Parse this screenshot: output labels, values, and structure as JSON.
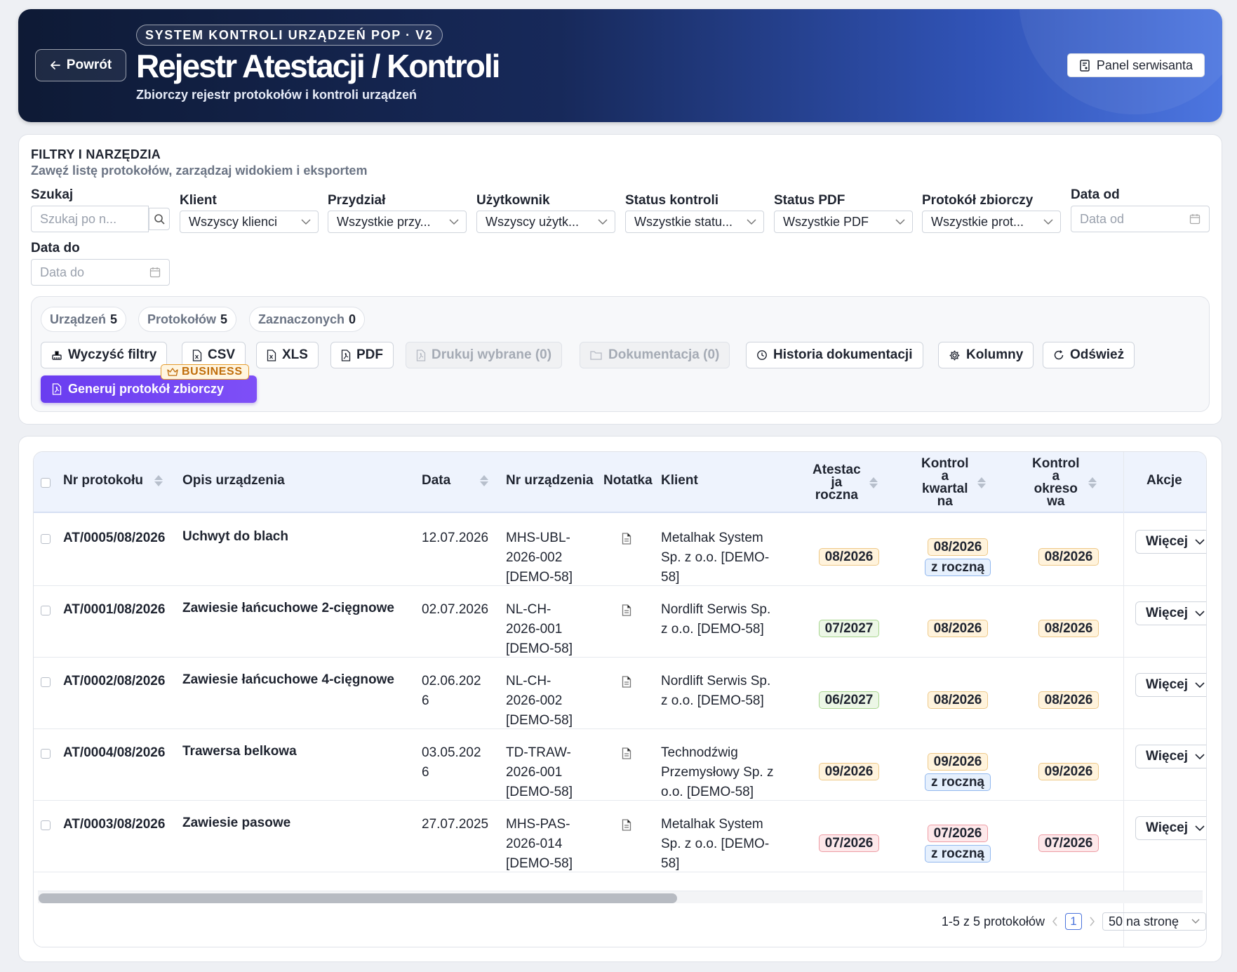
{
  "header": {
    "back_label": "Powrót",
    "badge": "SYSTEM KONTROLI URZĄDZEŃ POP · V2",
    "title": "Rejestr Atestacji / Kontroli",
    "subtitle": "Zbiorczy rejestr protokołów i kontroli urządzeń",
    "panel_button": "Panel serwisanta"
  },
  "filters": {
    "title": "FILTRY I NARZĘDZIA",
    "subtitle": "Zawęź listę protokołów, zarządzaj widokiem i eksportem",
    "search": {
      "label": "Szukaj",
      "placeholder": "Szukaj po n..."
    },
    "client": {
      "label": "Klient",
      "value": "Wszyscy klienci"
    },
    "assignment": {
      "label": "Przydział",
      "value": "Wszystkie przy..."
    },
    "user": {
      "label": "Użytkownik",
      "value": "Wszyscy użytk..."
    },
    "control_status": {
      "label": "Status kontroli",
      "value": "Wszystkie statu..."
    },
    "pdf_status": {
      "label": "Status PDF",
      "value": "Wszystkie PDF"
    },
    "collective": {
      "label": "Protokół zbiorczy",
      "value": "Wszystkie prot..."
    },
    "date_from": {
      "label": "Data od",
      "placeholder": "Data od"
    },
    "date_to": {
      "label": "Data do",
      "placeholder": "Data do"
    }
  },
  "stats": [
    {
      "label": "Urządzeń",
      "value": "5"
    },
    {
      "label": "Protokołów",
      "value": "5"
    },
    {
      "label": "Zaznaczonych",
      "value": "0"
    }
  ],
  "toolbar": {
    "clear": "Wyczyść filtry",
    "csv": "CSV",
    "xls": "XLS",
    "pdf": "PDF",
    "print_selected": "Drukuj wybrane (0)",
    "documentation": "Dokumentacja (0)",
    "history": "Historia dokumentacji",
    "columns": "Kolumny",
    "refresh": "Odśwież",
    "generate": "Generuj protokół zbiorczy",
    "business": "BUSINESS"
  },
  "table": {
    "headers": {
      "nr": "Nr protokołu",
      "opis": "Opis urządzenia",
      "data": "Data",
      "nr_urz": "Nr urządzenia",
      "notatka": "Notatka",
      "klient": "Klient",
      "atest_l1": "Atestac",
      "atest_l2": "ja",
      "atest_l3": "roczna",
      "kw_l1": "Kontrol",
      "kw_l2": "a",
      "kw_l3": "kwartal",
      "kw_l4": "na",
      "ok_l1": "Kontrol",
      "ok_l2": "a",
      "ok_l3": "okreso",
      "ok_l4": "wa",
      "akcje": "Akcje"
    },
    "more_label": "Więcej",
    "with_annual": "z roczną",
    "rows": [
      {
        "nr": "AT/0005/08/2026",
        "opis": "Uchwyt do blach",
        "data_l1": "12.07.2026",
        "data_l2": "",
        "urz_l1": "MHS-UBL-",
        "urz_l2": "2026-002",
        "urz_l3": "[DEMO-58]",
        "kl_l1": "Metalhak System",
        "kl_l2": "Sp. z o.o. [DEMO-",
        "kl_l3": "58]",
        "atest": "08/2026",
        "atest_color": "orange",
        "kw": "08/2026",
        "kw_color": "orange",
        "kw_annual": true,
        "ok": "08/2026",
        "ok_color": "orange"
      },
      {
        "nr": "AT/0001/08/2026",
        "opis": "Zawiesie łańcuchowe 2-cięgnowe",
        "data_l1": "02.07.2026",
        "data_l2": "",
        "urz_l1": "NL-CH-",
        "urz_l2": "2026-001",
        "urz_l3": "[DEMO-58]",
        "kl_l1": "Nordlift Serwis Sp.",
        "kl_l2": "z o.o. [DEMO-58]",
        "kl_l3": "",
        "atest": "07/2027",
        "atest_color": "green",
        "kw": "08/2026",
        "kw_color": "orange",
        "kw_annual": false,
        "ok": "08/2026",
        "ok_color": "orange"
      },
      {
        "nr": "AT/0002/08/2026",
        "opis": "Zawiesie łańcuchowe 4-cięgnowe",
        "data_l1": "02.06.202",
        "data_l2": "6",
        "urz_l1": "NL-CH-",
        "urz_l2": "2026-002",
        "urz_l3": "[DEMO-58]",
        "kl_l1": "Nordlift Serwis Sp.",
        "kl_l2": "z o.o. [DEMO-58]",
        "kl_l3": "",
        "atest": "06/2027",
        "atest_color": "green",
        "kw": "08/2026",
        "kw_color": "orange",
        "kw_annual": false,
        "ok": "08/2026",
        "ok_color": "orange"
      },
      {
        "nr": "AT/0004/08/2026",
        "opis": "Trawersa belkowa",
        "data_l1": "03.05.202",
        "data_l2": "6",
        "urz_l1": "TD-TRAW-",
        "urz_l2": "2026-001",
        "urz_l3": "[DEMO-58]",
        "kl_l1": "Technodźwig",
        "kl_l2": "Przemysłowy Sp. z",
        "kl_l3": "o.o. [DEMO-58]",
        "atest": "09/2026",
        "atest_color": "orange",
        "kw": "09/2026",
        "kw_color": "orange",
        "kw_annual": true,
        "ok": "09/2026",
        "ok_color": "orange"
      },
      {
        "nr": "AT/0003/08/2026",
        "opis": "Zawiesie pasowe",
        "data_l1": "27.07.2025",
        "data_l2": "",
        "urz_l1": "MHS-PAS-",
        "urz_l2": "2026-014",
        "urz_l3": "[DEMO-58]",
        "kl_l1": "Metalhak System",
        "kl_l2": "Sp. z o.o. [DEMO-",
        "kl_l3": "58]",
        "atest": "07/2026",
        "atest_color": "red",
        "kw": "07/2026",
        "kw_color": "red",
        "kw_annual": true,
        "ok": "07/2026",
        "ok_color": "red"
      }
    ]
  },
  "pagination": {
    "summary": "1-5 z 5 protokołów",
    "current_page": "1",
    "per_page": "50 na stronę"
  }
}
